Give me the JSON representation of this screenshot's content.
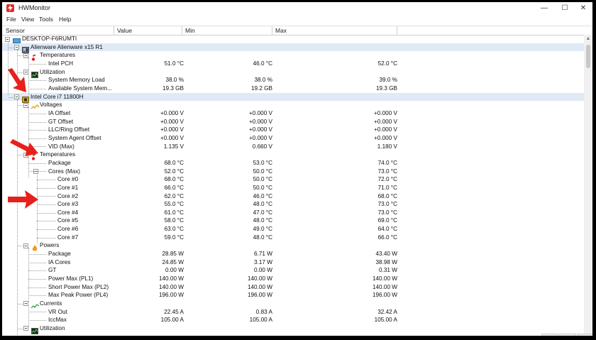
{
  "window": {
    "title": "HWMonitor"
  },
  "controls": {
    "minimize": "—",
    "maximize": "☐",
    "close": "✕"
  },
  "menu": [
    "File",
    "View",
    "Tools",
    "Help"
  ],
  "columns": [
    "Sensor",
    "Value",
    "Min",
    "Max"
  ],
  "colors": {
    "highlight": "#dfeaf6",
    "arrow": "#e8201b"
  },
  "rows": [
    {
      "label": "DESKTOP-F6RUMTI",
      "level": 0,
      "icon": "computer-icon",
      "expandable": true
    },
    {
      "label": "Alienware Alienware x15 R1",
      "level": 1,
      "icon": "motherboard-icon",
      "expandable": true,
      "highlight": true
    },
    {
      "label": "Temperatures",
      "level": 2,
      "icon": "thermometer-icon",
      "expandable": true
    },
    {
      "label": "Intel PCH",
      "level": 3,
      "value": "51.0 °C",
      "min": "46.0 °C",
      "max": "52.0 °C"
    },
    {
      "label": "Utilization",
      "level": 2,
      "icon": "utilization-icon",
      "expandable": true
    },
    {
      "label": "System Memory Load",
      "level": 3,
      "value": "38.0 %",
      "min": "38.0 %",
      "max": "39.0 %"
    },
    {
      "label": "Available System Mem...",
      "level": 3,
      "value": "19.3 GB",
      "min": "19.2 GB",
      "max": "19.3 GB"
    },
    {
      "label": "Intel Core i7 11800H",
      "level": 1,
      "icon": "cpu-icon",
      "expandable": true,
      "highlight": true
    },
    {
      "label": "Voltages",
      "level": 2,
      "icon": "voltage-icon",
      "expandable": true
    },
    {
      "label": "IA Offset",
      "level": 3,
      "value": "+0.000 V",
      "min": "+0.000 V",
      "max": "+0.000 V"
    },
    {
      "label": "GT Offset",
      "level": 3,
      "value": "+0.000 V",
      "min": "+0.000 V",
      "max": "+0.000 V"
    },
    {
      "label": "LLC/Ring Offset",
      "level": 3,
      "value": "+0.000 V",
      "min": "+0.000 V",
      "max": "+0.000 V"
    },
    {
      "label": "System Agent Offset",
      "level": 3,
      "value": "+0.000 V",
      "min": "+0.000 V",
      "max": "+0.000 V"
    },
    {
      "label": "VID (Max)",
      "level": 3,
      "value": "1.135 V",
      "min": "0.660 V",
      "max": "1.180 V"
    },
    {
      "label": "Temperatures",
      "level": 2,
      "icon": "thermometer-icon",
      "expandable": true
    },
    {
      "label": "Package",
      "level": 3,
      "value": "68.0 °C",
      "min": "53.0 °C",
      "max": "74.0 °C"
    },
    {
      "label": "Cores (Max)",
      "level": 3,
      "value": "52.0 °C",
      "min": "50.0 °C",
      "max": "73.0 °C",
      "expandable": true
    },
    {
      "label": "Core #0",
      "level": 4,
      "value": "68.0 °C",
      "min": "50.0 °C",
      "max": "72.0 °C"
    },
    {
      "label": "Core #1",
      "level": 4,
      "value": "66.0 °C",
      "min": "50.0 °C",
      "max": "71.0 °C"
    },
    {
      "label": "Core #2",
      "level": 4,
      "value": "62.0 °C",
      "min": "46.0 °C",
      "max": "68.0 °C"
    },
    {
      "label": "Core #3",
      "level": 4,
      "value": "55.0 °C",
      "min": "48.0 °C",
      "max": "73.0 °C"
    },
    {
      "label": "Core #4",
      "level": 4,
      "value": "61.0 °C",
      "min": "47.0 °C",
      "max": "73.0 °C"
    },
    {
      "label": "Core #5",
      "level": 4,
      "value": "58.0 °C",
      "min": "48.0 °C",
      "max": "69.0 °C"
    },
    {
      "label": "Core #6",
      "level": 4,
      "value": "63.0 °C",
      "min": "49.0 °C",
      "max": "64.0 °C"
    },
    {
      "label": "Core #7",
      "level": 4,
      "value": "59.0 °C",
      "min": "48.0 °C",
      "max": "66.0 °C"
    },
    {
      "label": "Powers",
      "level": 2,
      "icon": "power-icon",
      "expandable": true
    },
    {
      "label": "Package",
      "level": 3,
      "value": "28.85 W",
      "min": "6.71 W",
      "max": "43.40 W"
    },
    {
      "label": "IA Cores",
      "level": 3,
      "value": "24.85 W",
      "min": "3.17 W",
      "max": "38.98 W"
    },
    {
      "label": "GT",
      "level": 3,
      "value": "0.00 W",
      "min": "0.00 W",
      "max": "0.31 W"
    },
    {
      "label": "Power Max (PL1)",
      "level": 3,
      "value": "140.00 W",
      "min": "140.00 W",
      "max": "140.00 W"
    },
    {
      "label": "Short Power Max (PL2)",
      "level": 3,
      "value": "140.00 W",
      "min": "140.00 W",
      "max": "140.00 W"
    },
    {
      "label": "Max Peak Power (PL4)",
      "level": 3,
      "value": "196.00 W",
      "min": "196.00 W",
      "max": "196.00 W"
    },
    {
      "label": "Currents",
      "level": 2,
      "icon": "current-icon",
      "expandable": true
    },
    {
      "label": "VR Out",
      "level": 3,
      "value": "22.45 A",
      "min": "0.83 A",
      "max": "32.42 A"
    },
    {
      "label": "IccMax",
      "level": 3,
      "value": "105.00 A",
      "min": "105.00 A",
      "max": "105.00 A"
    },
    {
      "label": "Utilization",
      "level": 2,
      "icon": "utilization-icon",
      "expandable": true
    }
  ]
}
